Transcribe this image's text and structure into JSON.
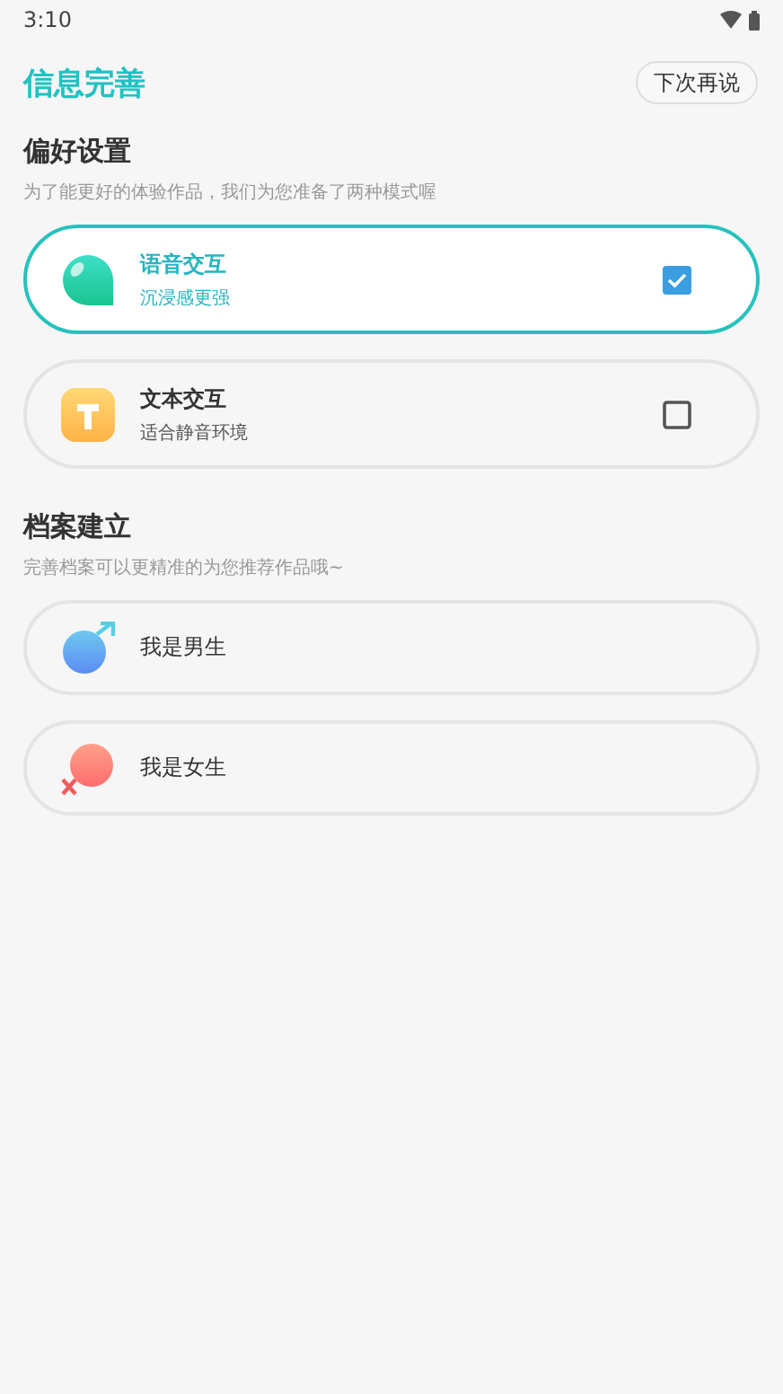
{
  "status_bar": {
    "time": "3:10"
  },
  "header": {
    "title": "信息完善",
    "skip_button": "下次再说"
  },
  "preferences": {
    "title": "偏好设置",
    "subtitle": "为了能更好的体验作品，我们为您准备了两种模式喔",
    "modes": [
      {
        "kind": "voice",
        "title": "语音交互",
        "description": "沉浸感更强",
        "selected": true
      },
      {
        "kind": "text",
        "title": "文本交互",
        "description": "适合静音环境",
        "selected": false
      }
    ]
  },
  "profile": {
    "title": "档案建立",
    "subtitle": "完善档案可以更精准的为您推荐作品哦~",
    "genders": [
      {
        "kind": "male",
        "label": "我是男生",
        "selected": false
      },
      {
        "kind": "female",
        "label": "我是女生",
        "selected": false
      }
    ]
  }
}
